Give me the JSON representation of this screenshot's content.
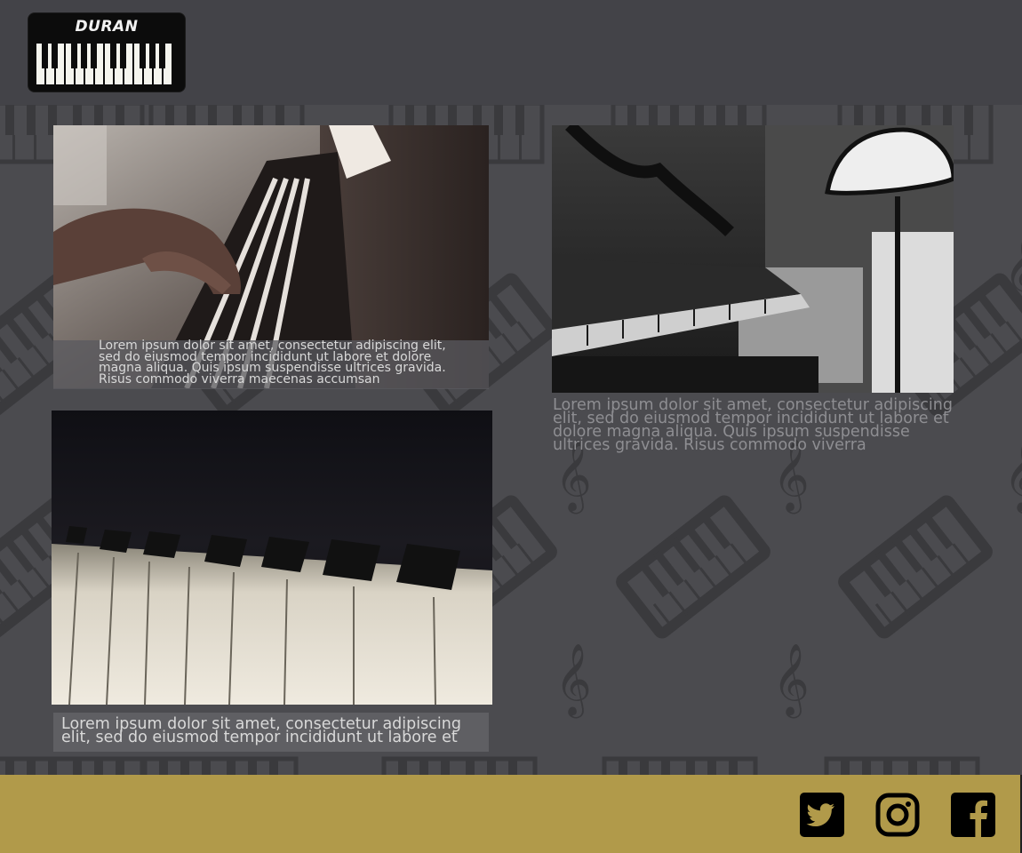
{
  "brand": {
    "logo_text": "DURAN",
    "logo_icon": "piano-keys-icon"
  },
  "gallery": [
    {
      "image_subject": "hands-playing-piano-photo",
      "caption": "Lorem ipsum dolor sit amet, consectetur adipiscing elit, sed do eiusmod tempor incididunt ut labore et dolore magna aliqua. Quis ipsum suspendisse ultrices gravida. Risus commodo viverra maecenas accumsan"
    },
    {
      "image_subject": "upright-piano-lamp-photo",
      "caption": "Lorem ipsum dolor sit amet, consectetur adipiscing elit, sed do eiusmod tempor incididunt ut labore et dolore magna aliqua. Quis ipsum suspendisse ultrices gravida. Risus commodo viverra"
    },
    {
      "image_subject": "piano-keys-closeup-photo",
      "caption": "Lorem ipsum dolor sit amet, consectetur adipiscing elit, sed do eiusmod tempor incididunt ut labore et"
    }
  ],
  "footer": {
    "social": [
      {
        "name": "twitter",
        "icon": "twitter-icon"
      },
      {
        "name": "instagram",
        "icon": "instagram-icon"
      },
      {
        "name": "facebook",
        "icon": "facebook-icon"
      }
    ]
  },
  "colors": {
    "header_bg": "#434348",
    "content_bg": "#4b4b4f",
    "footer_bg": "#b19a4a",
    "pattern": "#3a3a3d"
  }
}
